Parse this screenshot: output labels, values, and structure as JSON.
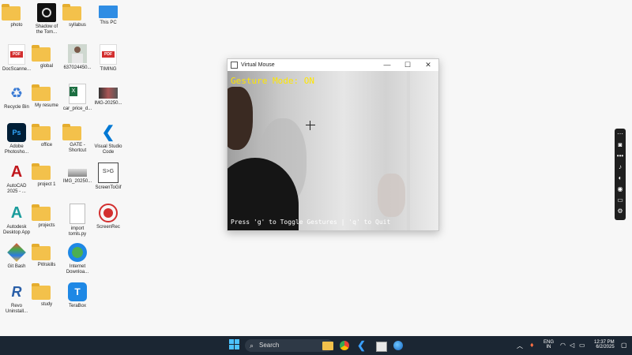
{
  "desktop": {
    "icons": [
      {
        "label": "photo",
        "type": "folder"
      },
      {
        "label": "Shadow of the Tom...",
        "type": "app"
      },
      {
        "label": "syllabus",
        "type": "folder"
      },
      {
        "label": "This PC",
        "type": "app"
      },
      {
        "label": "DocScanne...",
        "type": "pdf"
      },
      {
        "label": "global",
        "type": "folder"
      },
      {
        "label": "637024450...",
        "type": "image"
      },
      {
        "label": "TIMING",
        "type": "pdf"
      },
      {
        "label": "Recycle Bin",
        "type": "app"
      },
      {
        "label": "My resume",
        "type": "folder"
      },
      {
        "label": "car_price_d...",
        "type": "excel"
      },
      {
        "label": "IMG-20250...",
        "type": "image"
      },
      {
        "label": "Adobe Photosho...",
        "type": "app"
      },
      {
        "label": "office",
        "type": "folder"
      },
      {
        "label": "GATE - Shortcut",
        "type": "folder"
      },
      {
        "label": "Visual Studio Code",
        "type": "app"
      },
      {
        "label": "AutoCAD 2025 - ...",
        "type": "app"
      },
      {
        "label": "project 1",
        "type": "folder"
      },
      {
        "label": "IMG_20250...",
        "type": "image"
      },
      {
        "label": "ScreenToGif",
        "type": "app"
      },
      {
        "label": "Autodesk Desktop App",
        "type": "app"
      },
      {
        "label": "projects",
        "type": "folder"
      },
      {
        "label": "import tomls.py",
        "type": "file"
      },
      {
        "label": "ScreenRec",
        "type": "app"
      },
      {
        "label": "Git Bash",
        "type": "app"
      },
      {
        "label": "PWskills",
        "type": "folder"
      },
      {
        "label": "Internet Downloa...",
        "type": "app"
      },
      {
        "label": "Revo Uninstall...",
        "type": "app"
      },
      {
        "label": "study",
        "type": "folder"
      },
      {
        "label": "TeraBox",
        "type": "app"
      }
    ]
  },
  "window": {
    "title": "Virtual Mouse",
    "minimize": "—",
    "maximize": "☐",
    "close": "✕",
    "overlay_title": "Gesture Mode: ON",
    "overlay_help": "Press 'g' to Toggle Gestures | 'q' to Quit"
  },
  "taskbar": {
    "search_placeholder": "Search",
    "language": "ENG",
    "region": "IN",
    "time": "12:37 PM",
    "date": "6/2/2025"
  },
  "colors": {
    "overlay_title": "#ffe600",
    "taskbar": "#1b2633"
  }
}
